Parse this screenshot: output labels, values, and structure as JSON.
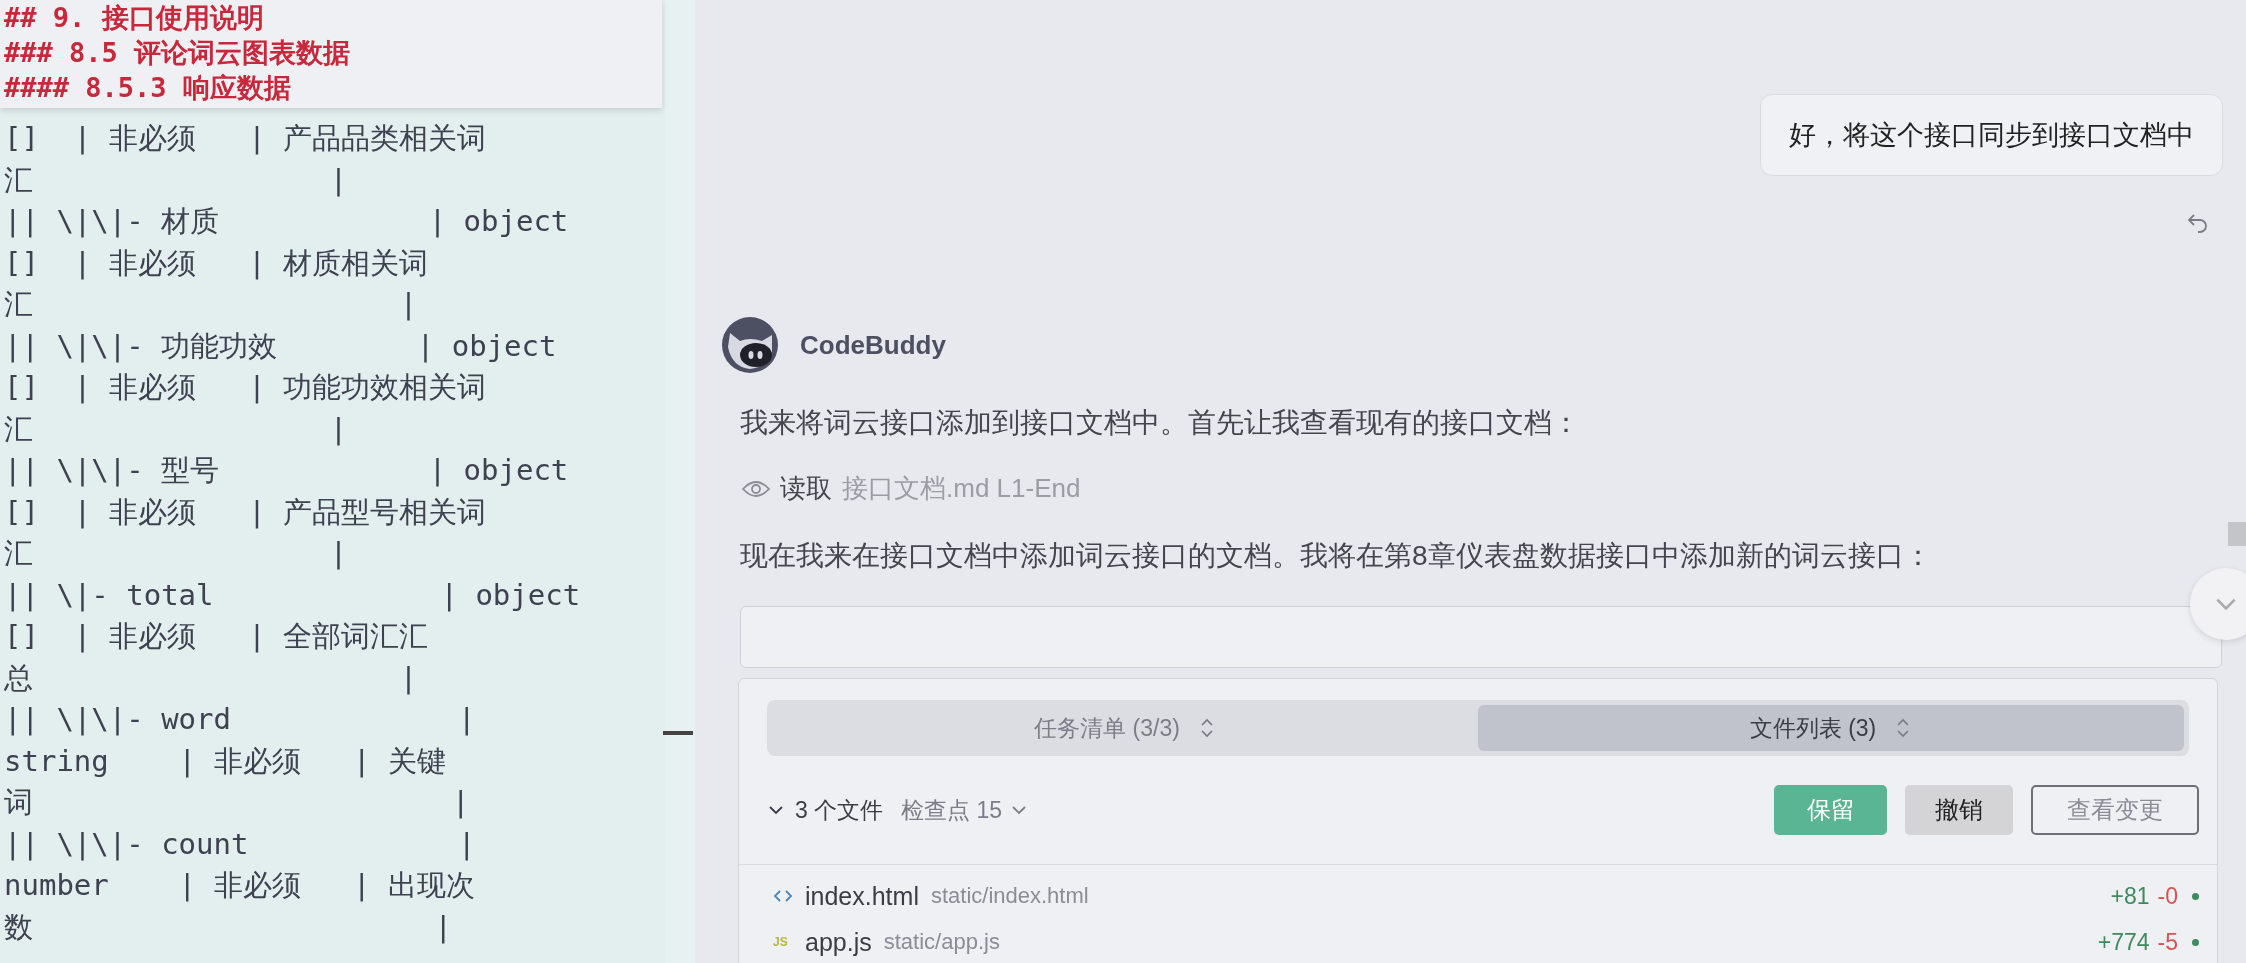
{
  "editor": {
    "header": [
      "## 9. 接口使用说明",
      "### 8.5 评论词云图表数据",
      "#### 8.5.3 响应数据"
    ],
    "lines": [
      "[]  | 非必须   | 产品品类相关词",
      "汇                 |",
      "|| \\|\\|- 材质            | object",
      "[]  | 非必须   | 材质相关词",
      "汇                     |",
      "|| \\|\\|- 功能功效        | object",
      "[]  | 非必须   | 功能功效相关词",
      "汇                 |",
      "|| \\|\\|- 型号            | object",
      "[]  | 非必须   | 产品型号相关词",
      "汇                 |",
      "|| \\|- total             | object",
      "[]  | 非必须   | 全部词汇汇",
      "总                     |",
      "|| \\|\\|- word             |",
      "string    | 非必须   | 关键",
      "词                        |",
      "|| \\|\\|- count            |",
      "number    | 非必须   | 出现次",
      "数                       |"
    ]
  },
  "chat": {
    "user_message": "好，将这个接口同步到接口文档中",
    "assistant": {
      "name": "CodeBuddy",
      "blocks": [
        {
          "kind": "text",
          "text": "我来将词云接口添加到接口文档中。首先让我查看现有的接口文档："
        },
        {
          "kind": "tool",
          "action": "读取",
          "target": "接口文档.md L1-End"
        },
        {
          "kind": "text",
          "text": "现在我来在接口文档中添加词云接口的文档。我将在第8章仪表盘数据接口中添加新的词云接口："
        },
        {
          "kind": "card"
        }
      ]
    }
  },
  "panel": {
    "tabs": [
      {
        "label": "任务清单 (3/3)",
        "selected": false
      },
      {
        "label": "文件列表 (3)",
        "selected": true
      }
    ],
    "summary": "3 个文件",
    "checkpoint": "检查点 15",
    "buttons": [
      {
        "label": "保留",
        "kind": "primary"
      },
      {
        "label": "撤销",
        "kind": "secondary"
      },
      {
        "label": "查看变更",
        "kind": "outline"
      }
    ],
    "files": [
      {
        "kind": "html",
        "name": "index.html",
        "path": "static/index.html",
        "added": "+81",
        "removed": "-0"
      },
      {
        "kind": "js",
        "icon_text": "JS",
        "name": "app.js",
        "path": "static/app.js",
        "added": "+774",
        "removed": "-5"
      }
    ]
  }
}
